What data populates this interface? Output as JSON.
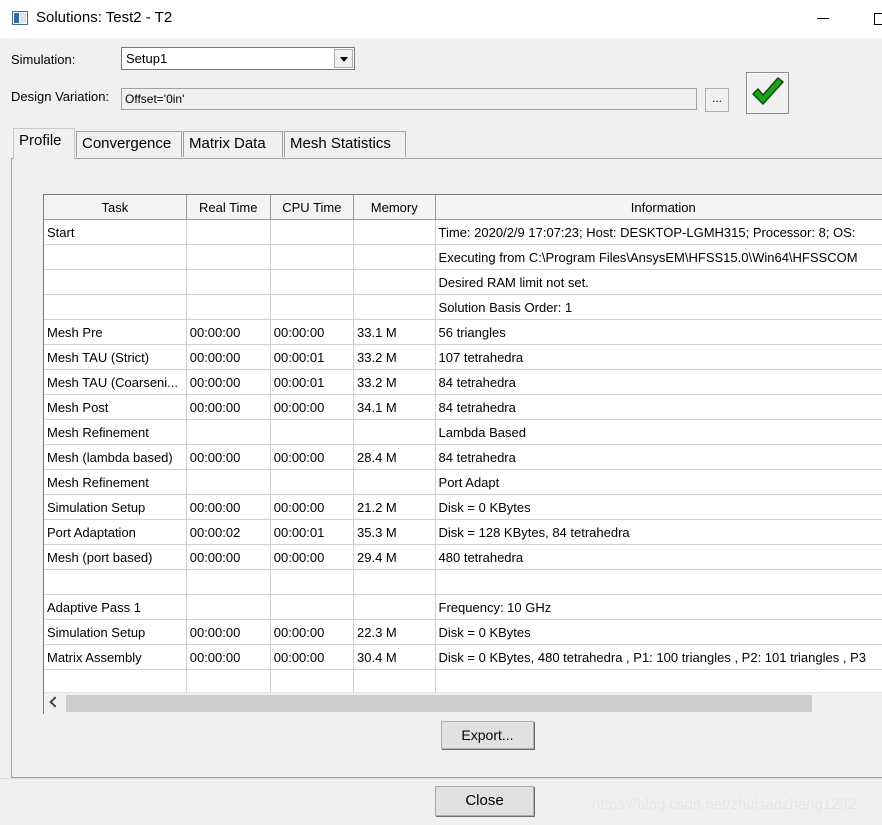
{
  "window": {
    "title": "Solutions: Test2 - T2"
  },
  "simulation": {
    "label": "Simulation:",
    "value": "Setup1"
  },
  "design_variation": {
    "label": "Design Variation:",
    "value": "Offset='0in'",
    "browse_label": "..."
  },
  "tabs": [
    {
      "label": "Profile",
      "active": true
    },
    {
      "label": "Convergence",
      "active": false
    },
    {
      "label": "Matrix Data",
      "active": false
    },
    {
      "label": "Mesh Statistics",
      "active": false
    }
  ],
  "table": {
    "columns": [
      "Task",
      "Real Time",
      "CPU Time",
      "Memory",
      "Information"
    ],
    "rows": [
      [
        "Start",
        "",
        "",
        "",
        "Time: 2020/2/9 17:07:23; Host: DESKTOP-LGMH315; Processor: 8; OS:"
      ],
      [
        "",
        "",
        "",
        "",
        "Executing from C:\\Program Files\\AnsysEM\\HFSS15.0\\Win64\\HFSSCOM"
      ],
      [
        "",
        "",
        "",
        "",
        "Desired RAM limit not set."
      ],
      [
        "",
        "",
        "",
        "",
        "Solution Basis Order: 1"
      ],
      [
        "Mesh Pre",
        "00:00:00",
        "00:00:00",
        "33.1 M",
        "56 triangles"
      ],
      [
        "Mesh TAU (Strict)",
        "00:00:00",
        "00:00:01",
        "33.2 M",
        "107 tetrahedra"
      ],
      [
        "Mesh TAU (Coarseni...",
        "00:00:00",
        "00:00:01",
        "33.2 M",
        "84 tetrahedra"
      ],
      [
        "Mesh Post",
        "00:00:00",
        "00:00:00",
        "34.1 M",
        "84 tetrahedra"
      ],
      [
        "Mesh Refinement",
        "",
        "",
        "",
        "Lambda Based"
      ],
      [
        "Mesh (lambda based)",
        "00:00:00",
        "00:00:00",
        "28.4 M",
        "84 tetrahedra"
      ],
      [
        "Mesh Refinement",
        "",
        "",
        "",
        "Port Adapt"
      ],
      [
        "Simulation Setup",
        "00:00:00",
        "00:00:00",
        "21.2 M",
        "Disk = 0 KBytes"
      ],
      [
        "Port Adaptation",
        "00:00:02",
        "00:00:01",
        "35.3 M",
        "Disk = 128 KBytes, 84 tetrahedra"
      ],
      [
        "Mesh (port based)",
        "00:00:00",
        "00:00:00",
        "29.4 M",
        "480 tetrahedra"
      ],
      [
        "",
        "",
        "",
        "",
        ""
      ],
      [
        "Adaptive Pass 1",
        "",
        "",
        "",
        "Frequency: 10  GHz"
      ],
      [
        "Simulation Setup",
        "00:00:00",
        "00:00:00",
        "22.3 M",
        "Disk = 0 KBytes"
      ],
      [
        "Matrix Assembly",
        "00:00:00",
        "00:00:00",
        "30.4 M",
        "Disk = 0 KBytes, 480 tetrahedra , P1: 100 triangles , P2: 101 triangles , P3"
      ],
      [
        "",
        "",
        "",
        "",
        ""
      ]
    ]
  },
  "buttons": {
    "export": "Export...",
    "close": "Close"
  },
  "watermark": "https://blog.csdn.net/zhulsaozhang1292",
  "colors": {
    "check_green": "#1aa31a",
    "window_bg": "#f0f0f0"
  }
}
